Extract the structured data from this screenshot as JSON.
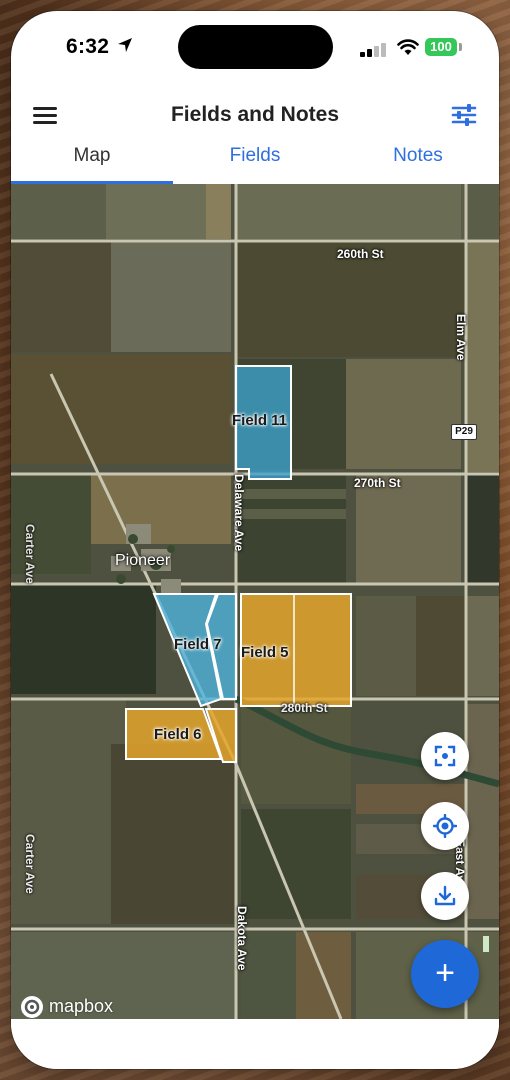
{
  "status_bar": {
    "time": "6:32",
    "battery": "100"
  },
  "header": {
    "title": "Fields and Notes",
    "menu_icon": "hamburger-icon",
    "filter_icon": "sliders-icon"
  },
  "tabs": [
    {
      "label": "Map",
      "active": true
    },
    {
      "label": "Fields",
      "active": false
    },
    {
      "label": "Notes",
      "active": false
    }
  ],
  "map": {
    "roads": {
      "r260_top": "260th St",
      "r270": "270th St",
      "r280": "280th St",
      "elm": "Elm Ave",
      "delaware": "Delaware Ave",
      "dakota": "Dakota Ave",
      "carter": "Carter Ave",
      "carter_lower": "Carter Ave",
      "east": "East Ave"
    },
    "highway_shield": "P29",
    "town": "Pioneer",
    "fields": [
      {
        "label": "Field 11",
        "color": "#3b9fc9"
      },
      {
        "label": "Field 7",
        "color": "#4fb3dc"
      },
      {
        "label": "Field 5",
        "color": "#e4a52c"
      },
      {
        "label": "Field 6",
        "color": "#e4a52c"
      }
    ],
    "attribution": "mapbox"
  },
  "controls": {
    "focus_icon": "focus-frame-icon",
    "locate_icon": "locate-crosshair-icon",
    "download_icon": "download-icon",
    "add_label": "+"
  },
  "colors": {
    "accent": "#2f6fe0",
    "fab": "#1f68d8",
    "battery": "#35c759"
  }
}
